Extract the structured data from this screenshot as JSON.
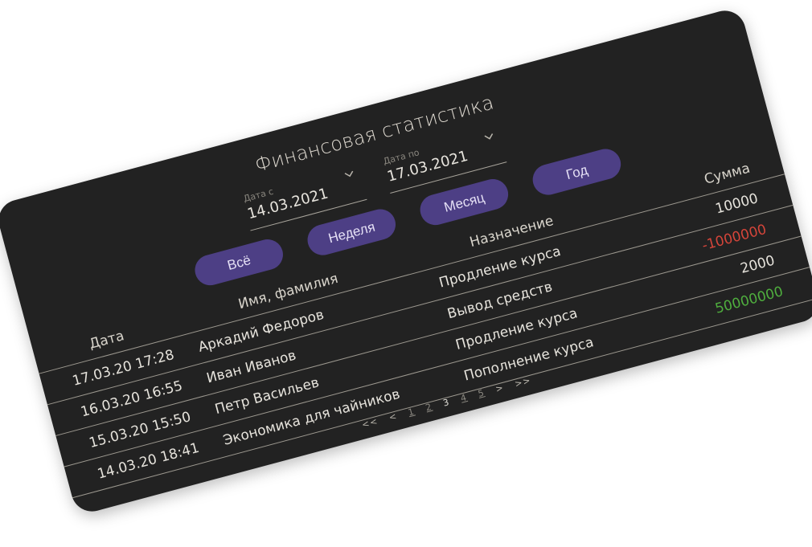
{
  "header": {
    "title": "Финансовая статистика"
  },
  "filters": {
    "from": {
      "caption": "Дата с",
      "value": "14.03.2021"
    },
    "to": {
      "caption": "Дата по",
      "value": "17.03.2021"
    }
  },
  "period_buttons": {
    "all": "Всё",
    "week": "Неделя",
    "month": "Месяц",
    "year": "Год"
  },
  "table": {
    "columns": [
      "Дата",
      "Имя, фамилия",
      "Назначение",
      "Сумма"
    ],
    "rows": [
      {
        "date": "17.03.20 17:28",
        "name": "Аркадий Федоров",
        "purpose": "Продление курса",
        "sum": "10000",
        "sum_color": "neutral"
      },
      {
        "date": "16.03.20 16:55",
        "name": "Иван Иванов",
        "purpose": "Вывод средств",
        "sum": "-1000000",
        "sum_color": "red"
      },
      {
        "date": "15.03.20 15:50",
        "name": "Петр Васильев",
        "purpose": "Продление курса",
        "sum": "2000",
        "sum_color": "neutral"
      },
      {
        "date": "14.03.20 18:41",
        "name": "Экономика для чайников",
        "purpose": "Пополнение курса",
        "sum": "50000000",
        "sum_color": "green"
      }
    ]
  },
  "pagination": {
    "first": "<<",
    "prev": "<",
    "pages": [
      "1",
      "2",
      "3",
      "4",
      "5"
    ],
    "current": "3",
    "next": ">",
    "last": ">>"
  },
  "colors": {
    "card_bg": "#222222",
    "button_bg": "#4d3f85",
    "negative": "#d4453a",
    "positive": "#4fae3e"
  }
}
